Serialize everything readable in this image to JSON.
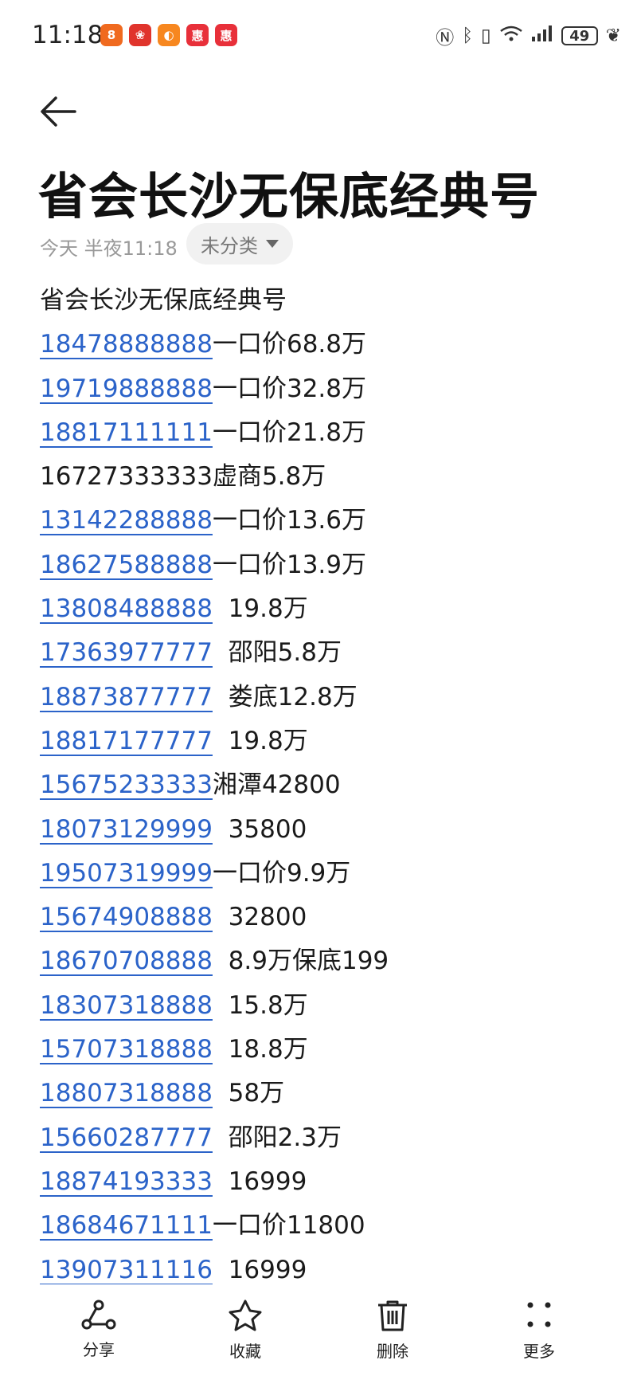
{
  "status": {
    "time": "11:18",
    "battery": "49",
    "app_icons": [
      {
        "name": "app-icon-1",
        "color": "#f06a1f",
        "glyph": "8"
      },
      {
        "name": "app-icon-2",
        "color": "#e0342c",
        "glyph": "❀"
      },
      {
        "name": "app-icon-3",
        "color": "#f7871f",
        "glyph": "◐"
      },
      {
        "name": "app-icon-4",
        "color": "#e8303a",
        "glyph": "惠"
      },
      {
        "name": "app-icon-5",
        "color": "#e8303a",
        "glyph": "惠"
      }
    ]
  },
  "note": {
    "title": "省会长沙无保底经典号",
    "meta_time": "今天 半夜11:18",
    "category": "未分类",
    "lines": [
      {
        "phone": "",
        "text": "省会长沙无保底经典号"
      },
      {
        "phone": "18478888888",
        "text": "一口价68.8万"
      },
      {
        "phone": "19719888888",
        "text": "一口价32.8万"
      },
      {
        "phone": "18817111111",
        "text": "一口价21.8万"
      },
      {
        "phone": "",
        "text": "16727333333虚商5.8万"
      },
      {
        "phone": "13142288888",
        "text": "一口价13.6万"
      },
      {
        "phone": "18627588888",
        "text": "一口价13.9万"
      },
      {
        "phone": "13808488888",
        "text": "  19.8万"
      },
      {
        "phone": "17363977777",
        "text": "  邵阳5.8万"
      },
      {
        "phone": "18873877777",
        "text": "  娄底12.8万"
      },
      {
        "phone": "18817177777",
        "text": "  19.8万"
      },
      {
        "phone": "15675233333",
        "text": "湘潭42800"
      },
      {
        "phone": "18073129999",
        "text": "  35800"
      },
      {
        "phone": "19507319999",
        "text": "一口价9.9万"
      },
      {
        "phone": "15674908888",
        "text": "  32800"
      },
      {
        "phone": "18670708888",
        "text": "  8.9万保底199"
      },
      {
        "phone": "18307318888",
        "text": "  15.8万"
      },
      {
        "phone": "15707318888",
        "text": "  18.8万"
      },
      {
        "phone": "18807318888",
        "text": "  58万"
      },
      {
        "phone": "15660287777",
        "text": "  邵阳2.3万"
      },
      {
        "phone": "18874193333",
        "text": "  16999"
      },
      {
        "phone": "18684671111",
        "text": "一口价11800"
      },
      {
        "phone": "13907311116",
        "text": "  16999"
      }
    ]
  },
  "actions": {
    "share": "分享",
    "favorite": "收藏",
    "delete": "删除",
    "more": "更多"
  }
}
